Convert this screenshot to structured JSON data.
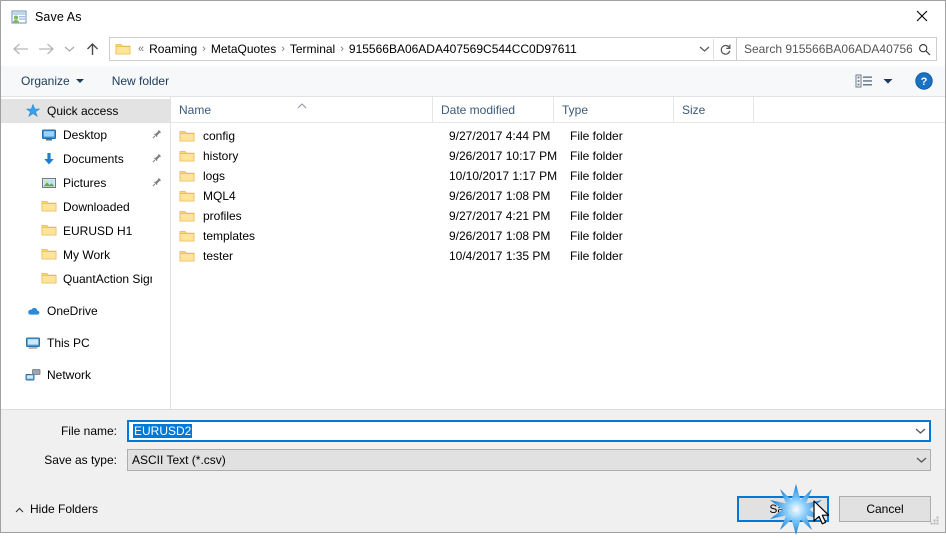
{
  "window": {
    "title": "Save As",
    "icon": "save-as-app-icon",
    "close_icon": "close-icon"
  },
  "navbar": {
    "back_icon": "back-arrow-icon",
    "forward_icon": "forward-arrow-icon",
    "recent_icon": "chevron-down-icon",
    "up_icon": "up-arrow-icon",
    "folder_icon": "folder-icon",
    "overflow_prefix": "«",
    "breadcrumbs": [
      "Roaming",
      "MetaQuotes",
      "Terminal",
      "915566BA06ADA407569C544CC0D97611"
    ],
    "separator": "›",
    "dropdown_icon": "chevron-down-icon",
    "refresh_icon": "refresh-icon",
    "search_placeholder": "Search 915566BA06ADA40756...",
    "search_icon": "search-icon"
  },
  "toolbar": {
    "organize_label": "Organize",
    "new_folder_label": "New folder",
    "view_icon": "view-layout-icon",
    "view_caret_icon": "chevron-down-icon",
    "help_icon": "help-icon",
    "help_glyph": "?"
  },
  "sidebar": {
    "items": [
      {
        "label": "Quick access",
        "icon": "star-icon",
        "level": 0,
        "selected": true,
        "pinned": false
      },
      {
        "label": "Desktop",
        "icon": "desktop-icon",
        "level": 1,
        "selected": false,
        "pinned": true
      },
      {
        "label": "Documents",
        "icon": "documents-download-icon",
        "level": 1,
        "selected": false,
        "pinned": true
      },
      {
        "label": "Pictures",
        "icon": "pictures-icon",
        "level": 1,
        "selected": false,
        "pinned": true
      },
      {
        "label": "Downloaded",
        "icon": "folder-icon",
        "level": 1,
        "selected": false,
        "pinned": false
      },
      {
        "label": "EURUSD H1",
        "icon": "folder-icon",
        "level": 1,
        "selected": false,
        "pinned": false
      },
      {
        "label": "My Work",
        "icon": "folder-icon",
        "level": 1,
        "selected": false,
        "pinned": false
      },
      {
        "label": "QuantAction Signal",
        "icon": "folder-icon",
        "level": 1,
        "selected": false,
        "pinned": false
      },
      {
        "label": "OneDrive",
        "icon": "onedrive-cloud-icon",
        "level": 0,
        "selected": false,
        "pinned": false
      },
      {
        "label": "This PC",
        "icon": "this-pc-icon",
        "level": 0,
        "selected": false,
        "pinned": false
      },
      {
        "label": "Network",
        "icon": "network-icon",
        "level": 0,
        "selected": false,
        "pinned": false
      }
    ]
  },
  "filelist": {
    "columns": [
      "Name",
      "Date modified",
      "Type",
      "Size"
    ],
    "sort_column": "Name",
    "sort_direction": "ascending",
    "rows": [
      {
        "name": "config",
        "date": "9/27/2017 4:44 PM",
        "type": "File folder",
        "size": ""
      },
      {
        "name": "history",
        "date": "9/26/2017 10:17 PM",
        "type": "File folder",
        "size": ""
      },
      {
        "name": "logs",
        "date": "10/10/2017 1:17 PM",
        "type": "File folder",
        "size": ""
      },
      {
        "name": "MQL4",
        "date": "9/26/2017 1:08 PM",
        "type": "File folder",
        "size": ""
      },
      {
        "name": "profiles",
        "date": "9/27/2017 4:21 PM",
        "type": "File folder",
        "size": ""
      },
      {
        "name": "templates",
        "date": "9/26/2017 1:08 PM",
        "type": "File folder",
        "size": ""
      },
      {
        "name": "tester",
        "date": "10/4/2017 1:35 PM",
        "type": "File folder",
        "size": ""
      }
    ]
  },
  "form": {
    "file_name_label": "File name:",
    "file_name_value": "EURUSD2",
    "save_as_type_label": "Save as type:",
    "save_as_type_value": "ASCII Text (*.csv)",
    "dropdown_icon": "chevron-down-icon"
  },
  "footer": {
    "hide_folders_label": "Hide Folders",
    "hide_folders_icon": "chevron-up-icon",
    "save_label": "Save",
    "cancel_label": "Cancel",
    "resize_grip_icon": "resize-grip-icon"
  },
  "pointer": {
    "click_effect_icon": "click-sparkle-icon",
    "cursor_icon": "arrow-cursor-icon",
    "accent_color": "#0078d7"
  }
}
